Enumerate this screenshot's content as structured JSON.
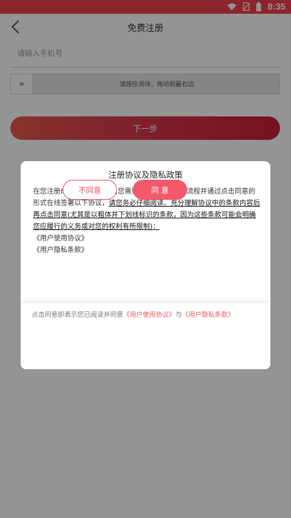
{
  "status_bar": {
    "time": "8:35",
    "icons": [
      "wifi-icon",
      "no-sim-icon",
      "battery-icon"
    ]
  },
  "header": {
    "title": "免费注册"
  },
  "form": {
    "phone_placeholder": "请输入手机号",
    "slider_handle": "»",
    "slider_hint": "请按住滑块，拖动到最右边",
    "next_label": "下一步"
  },
  "dialog": {
    "title": "注册协议及隐私政策",
    "intro": "在您注册成为用户的过程中,您需要完成我们的注册流程并通过点击同意的形式在线签署以下协议，",
    "underlined": "请您务必仔细阅读、充分理解协议中的条款内容后再点击同意(尤其是以粗体并下划线标识的条款，因为这些条款可能会明确您应履行的义务或对您的权利有所限制)：",
    "items": [
      "《用户使用协议》",
      "《用户隐私条款》"
    ],
    "notice_prefix": "点击同意即表示您已阅读并同意",
    "notice_link1": "《用户使用协议》",
    "notice_mid": "与",
    "notice_link2": "《用户隐私条款》",
    "disagree_label": "不同意",
    "agree_label": "同 意"
  },
  "colors": {
    "status_bar": "#f2404a",
    "accent": "#f3586b",
    "link": "#e45c5c"
  }
}
